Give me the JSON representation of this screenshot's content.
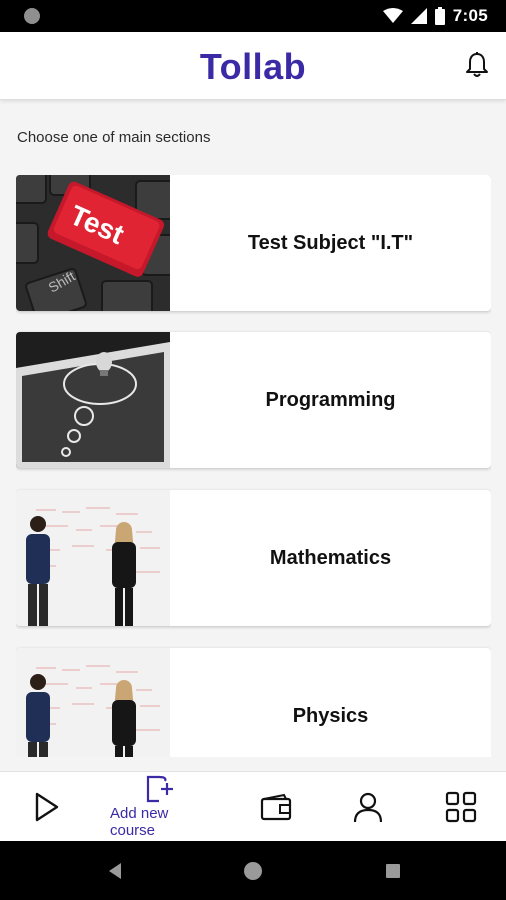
{
  "status_bar": {
    "time": "7:05"
  },
  "header": {
    "title": "Tollab"
  },
  "content": {
    "hint": "Choose one of main sections"
  },
  "sections": [
    {
      "title": "Test Subject \"I.T\"",
      "image_key_text": "Test",
      "image_key_sub": "Shift"
    },
    {
      "title": "Programming"
    },
    {
      "title": "Mathematics"
    },
    {
      "title": "Physics"
    }
  ],
  "bottom_nav": {
    "add_course_label": "Add new course"
  },
  "colors": {
    "accent": "#3b2aa6"
  }
}
